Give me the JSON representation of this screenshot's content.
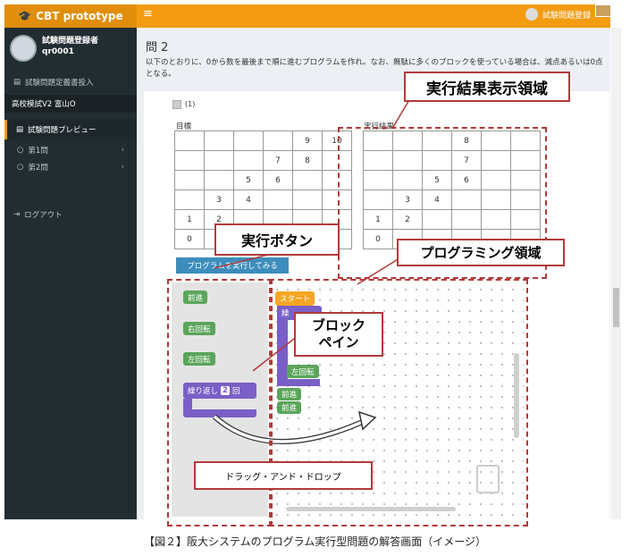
{
  "app": {
    "brand": "CBT prototype",
    "menu_icon": "hamburger-icon"
  },
  "header": {
    "user_label": "試験問題登録"
  },
  "sidebar": {
    "user_name": "試験問題登録者",
    "user_id": "qr0001",
    "items": [
      {
        "label": "試験問題定義書投入"
      },
      {
        "label": "高校模試V2 富山O"
      },
      {
        "label": "試験問題プレビュー"
      },
      {
        "label": "第1問"
      },
      {
        "label": "第2問"
      },
      {
        "label": "ログアウト"
      }
    ]
  },
  "question": {
    "title": "問 2",
    "text": "以下のとおりに、0から数を最後まで順に進むプログラムを作れ。なお、無駄に多くのブロックを使っている場合は、減点あるいは0点となる。",
    "item_label": "(1)"
  },
  "target": {
    "label": "目標",
    "cells": [
      "",
      "",
      "",
      "",
      "9",
      "10",
      "",
      "",
      "",
      "7",
      "8",
      "",
      "",
      "",
      "5",
      "6",
      "",
      "",
      "",
      "3",
      "4",
      "",
      "",
      "",
      "1",
      "2",
      "",
      "",
      "",
      "",
      "0",
      "",
      "",
      "",
      "",
      ""
    ]
  },
  "result": {
    "label": "実行結果",
    "cells": [
      "",
      "",
      "",
      "8",
      "",
      "",
      "",
      "",
      "",
      "7",
      "",
      "",
      "",
      "",
      "5",
      "6",
      "",
      "",
      "",
      "3",
      "4",
      "",
      "",
      "",
      "1",
      "2",
      "",
      "",
      "",
      "",
      "0",
      "",
      "",
      "",
      "",
      ""
    ]
  },
  "run_button": "プログラムを実行してみる",
  "blocks": {
    "forward": "前進",
    "turn_right": "右回転",
    "turn_left": "左回転",
    "repeat": "繰り返し",
    "repeat_count": "2",
    "repeat_unit": "回"
  },
  "program": {
    "start": "スタート",
    "b1": "繰",
    "b2": "左回転",
    "b3": "前進",
    "b4": "前進"
  },
  "annotations": {
    "result_area": "実行結果表示領域",
    "run_button": "実行ボタン",
    "programming_area": "プログラミング領域",
    "block_pane": "ブロック\nペイン",
    "drag_drop": "ドラッグ・アンド・ドロップ"
  },
  "caption": "【図２】阪大システムのプログラム実行型問題の解答画面（イメージ）",
  "colors": {
    "header": "#f39c12",
    "sidebar": "#222d32",
    "annotation": "#b23a3a",
    "block_green": "#5ba55b",
    "block_purple": "#7a5fc7",
    "block_orange": "#f5a623"
  }
}
